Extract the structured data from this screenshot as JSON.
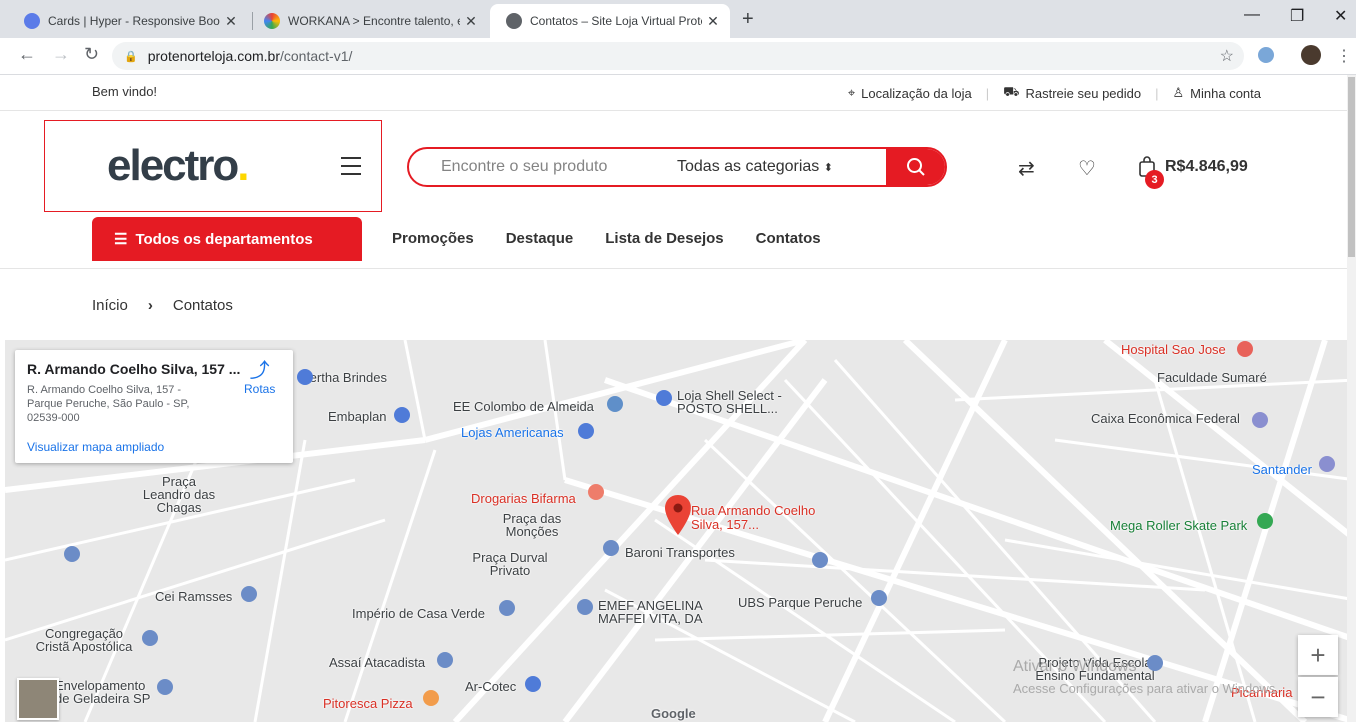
{
  "browser": {
    "tabs": [
      {
        "title": "Cards | Hyper - Responsive Boots",
        "active": false,
        "favicon_color": "#5b7be8"
      },
      {
        "title": "WORKANA > Encontre talento, e",
        "active": false,
        "favicon_color": "#34a853"
      },
      {
        "title": "Contatos – Site Loja Virtual Prote",
        "active": true,
        "favicon_color": "#5f6368"
      }
    ],
    "url_host": "protenorteloja.com.br",
    "url_path": "/contact-v1/"
  },
  "topbar": {
    "welcome": "Bem vindo!",
    "links": [
      {
        "icon": "map-pin-icon",
        "label": "Localização da loja"
      },
      {
        "icon": "truck-icon",
        "label": "Rastreie seu pedido"
      },
      {
        "icon": "user-icon",
        "label": "Minha conta"
      }
    ]
  },
  "header": {
    "logo": "electro",
    "logo_dot": ".",
    "search_placeholder": "Encontre o seu produto",
    "category": "Todas as categorias",
    "cart_count": "3",
    "cart_total": "R$4.846,99"
  },
  "nav": {
    "departments": "Todos os departamentos",
    "items": [
      "Promoções",
      "Destaque",
      "Lista de Desejos",
      "Contatos"
    ]
  },
  "breadcrumb": {
    "home": "Início",
    "current": "Contatos"
  },
  "map": {
    "card_title": "R. Armando Coelho Silva, 157 ...",
    "card_address": "R. Armando Coelho Silva, 157 - Parque Peruche, São Paulo - SP, 02539-000",
    "directions": "Rotas",
    "larger_map": "Visualizar mapa ampliado",
    "marker_label": "Rua Armando Coelho Silva, 157...",
    "places": [
      "Sertha Brindes",
      "Embaplan",
      "EE Colombo de Almeida",
      "Lojas Americanas",
      "Loja Shell Select - POSTO SHELL...",
      "Hospital Sao Jose",
      "Faculdade Sumaré",
      "Caixa Econômica Federal",
      "Santander",
      "Mega Roller Skate Park",
      "Drogarias Bifarma",
      "Praça das Monções",
      "Baroni Transportes",
      "Praça Durval Privato",
      "Praça Leandro das Chagas",
      "Cei Ramsses",
      "Império de Casa Verde",
      "EMEF ANGELINA MAFFEI VITA, DA",
      "UBS Parque Peruche",
      "Congregação Cristã Apostólica",
      "Assaí Atacadista",
      "Ar-Cotec",
      "Envelopamento de Geladeira SP",
      "Pitoresca Pizza",
      "Projeto Vida Escola Ensino Fundamental",
      "Picanharia",
      "Google"
    ],
    "os_notice_1": "Ativar o Windows",
    "os_notice_2": "Acesse Configurações para ativar o Windows."
  }
}
